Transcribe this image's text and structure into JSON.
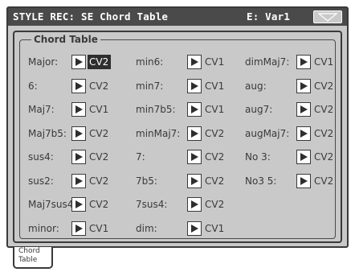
{
  "titlebar": {
    "title": "STYLE REC: SE Chord Table",
    "variation": "E: Var1",
    "menu_icon": "triangle-down-icon"
  },
  "group": {
    "title": "Chord Table"
  },
  "chords": [
    {
      "label": "Major:",
      "value": "CV2",
      "selected": true
    },
    {
      "label": "6:",
      "value": "CV2"
    },
    {
      "label": "Maj7:",
      "value": "CV1"
    },
    {
      "label": "Maj7b5:",
      "value": "CV2"
    },
    {
      "label": "sus4:",
      "value": "CV2"
    },
    {
      "label": "sus2:",
      "value": "CV2"
    },
    {
      "label": "Maj7sus4:",
      "value": "CV2"
    },
    {
      "label": "minor:",
      "value": "CV1"
    },
    {
      "label": "min6:",
      "value": "CV1"
    },
    {
      "label": "min7:",
      "value": "CV1"
    },
    {
      "label": "min7b5:",
      "value": "CV1"
    },
    {
      "label": "minMaj7:",
      "value": "CV2"
    },
    {
      "label": "7:",
      "value": "CV2"
    },
    {
      "label": "7b5:",
      "value": "CV2"
    },
    {
      "label": "7sus4:",
      "value": "CV2"
    },
    {
      "label": "dim:",
      "value": "CV1"
    },
    {
      "label": "dimMaj7:",
      "value": "CV1"
    },
    {
      "label": "aug:",
      "value": "CV2"
    },
    {
      "label": "aug7:",
      "value": "CV2"
    },
    {
      "label": "augMaj7:",
      "value": "CV2"
    },
    {
      "label": "No 3:",
      "value": "CV2"
    },
    {
      "label": "No3 5:",
      "value": "CV2"
    }
  ],
  "tab": {
    "label": "Chord\nTable"
  },
  "colors": {
    "panel": "#c9c9c9",
    "titlebar": "#4a4a4a",
    "text": "#3a3a3a",
    "selected": "#2e2e2e",
    "field": "#ffffff"
  }
}
